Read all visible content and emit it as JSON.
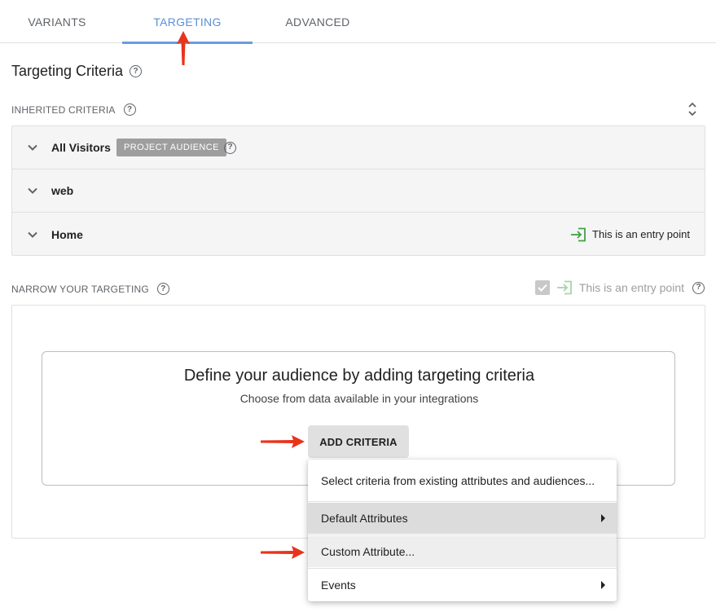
{
  "tabs": [
    {
      "label": "VARIANTS",
      "active": false
    },
    {
      "label": "TARGETING",
      "active": true
    },
    {
      "label": "ADVANCED",
      "active": false
    }
  ],
  "section_title": "Targeting Criteria",
  "inherited": {
    "label": "INHERITED CRITERIA",
    "rows": [
      {
        "title": "All Visitors",
        "badge": "PROJECT AUDIENCE"
      },
      {
        "title": "web"
      },
      {
        "title": "Home",
        "entry_point": "This is an entry point"
      }
    ]
  },
  "narrow": {
    "label": "NARROW YOUR TARGETING",
    "entry_point_label": "This is an entry point",
    "entry_point_checked": true,
    "card_heading": "Define your audience by adding targeting criteria",
    "card_sub": "Choose from data available in your integrations",
    "add_button": "ADD CRITERIA"
  },
  "menu": {
    "items": [
      {
        "label": "Select criteria from existing attributes and audiences...",
        "submenu": false
      },
      {
        "label": "Default Attributes",
        "submenu": true,
        "highlighted": true
      },
      {
        "label": "Custom Attribute...",
        "submenu": false,
        "hovered": true
      },
      {
        "label": "Events",
        "submenu": true
      }
    ]
  },
  "colors": {
    "accent": "#6a9ae0",
    "annotation_arrow": "#e8341c",
    "entry_icon": "#43a047",
    "badge": "#9e9e9e"
  },
  "icons": {
    "help": "help-circle-icon",
    "chevron": "chevron-down-icon",
    "entry": "sign-in-icon",
    "sort": "unfold-icon",
    "submenu": "caret-right-icon"
  }
}
